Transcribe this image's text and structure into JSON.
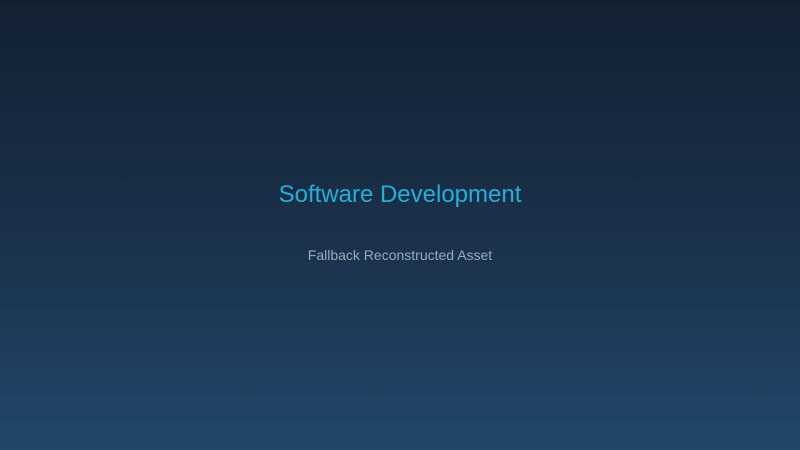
{
  "screen": {
    "title": "Software Development",
    "subtitle": "Fallback Reconstructed Asset"
  },
  "colors": {
    "title": "#1fb1d8",
    "subtitle": "#9aa9b8",
    "background_top": "#132133",
    "background_bottom": "#22476b"
  }
}
